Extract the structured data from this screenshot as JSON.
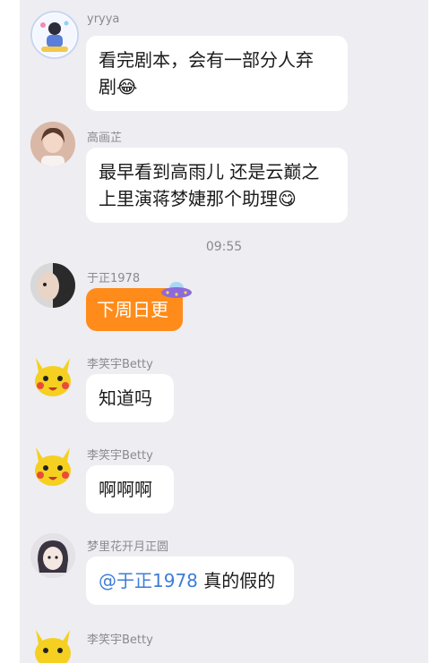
{
  "chat": {
    "time_divider": "09:55",
    "messages": [
      {
        "sender": "yryya",
        "text": "看完剧本，会有一部分人弃剧😂",
        "line1": "看完剧本，会有一部分人弃",
        "line2": "剧😂"
      },
      {
        "sender": "高画芷",
        "line1": "最早看到高雨儿 还是云巅之",
        "line2": "上里演蒋梦婕那个助理😋"
      },
      {
        "sender": "于正1978",
        "text": "下周日更"
      },
      {
        "sender": "李笑宇Betty",
        "text": "知道吗"
      },
      {
        "sender": "李笑宇Betty",
        "text": "啊啊啊"
      },
      {
        "sender": "梦里花开月正圆",
        "mention": "@于正1978",
        "text": " 真的假的"
      },
      {
        "sender": "李笑宇Betty"
      }
    ]
  },
  "colors": {
    "background": "#eeedf2",
    "bubble": "#ffffff",
    "highlight_bubble": "#ff8c1a",
    "mention": "#3e7dd7"
  },
  "icons": {
    "ufo_sticker": "ufo-icon"
  }
}
